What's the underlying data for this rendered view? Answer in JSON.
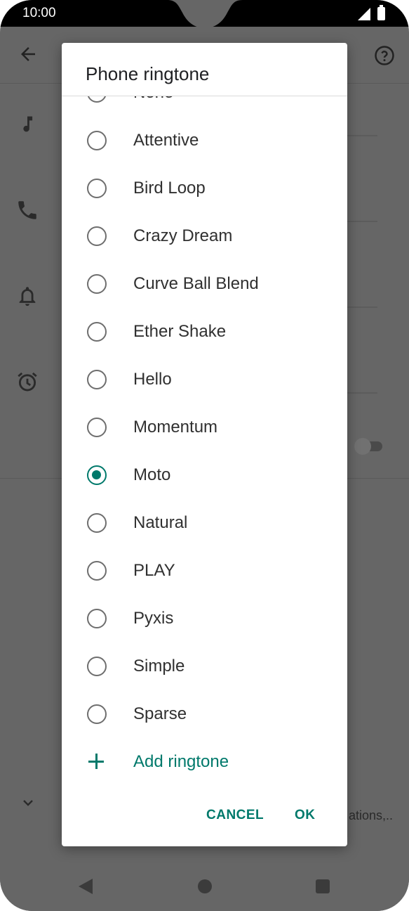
{
  "status_bar": {
    "time": "10:00"
  },
  "background": {
    "trailing_text": "ations,.."
  },
  "dialog": {
    "title": "Phone ringtone",
    "options": [
      {
        "label": "None",
        "checked": false
      },
      {
        "label": "Attentive",
        "checked": false
      },
      {
        "label": "Bird Loop",
        "checked": false
      },
      {
        "label": "Crazy Dream",
        "checked": false
      },
      {
        "label": "Curve Ball Blend",
        "checked": false
      },
      {
        "label": "Ether Shake",
        "checked": false
      },
      {
        "label": "Hello",
        "checked": false
      },
      {
        "label": "Momentum",
        "checked": false
      },
      {
        "label": "Moto",
        "checked": true
      },
      {
        "label": "Natural",
        "checked": false
      },
      {
        "label": "PLAY",
        "checked": false
      },
      {
        "label": "Pyxis",
        "checked": false
      },
      {
        "label": "Simple",
        "checked": false
      },
      {
        "label": "Sparse",
        "checked": false
      }
    ],
    "add_label": "Add ringtone",
    "cancel_label": "CANCEL",
    "ok_label": "OK"
  },
  "colors": {
    "accent": "#00796b",
    "scrim": "#666666"
  }
}
